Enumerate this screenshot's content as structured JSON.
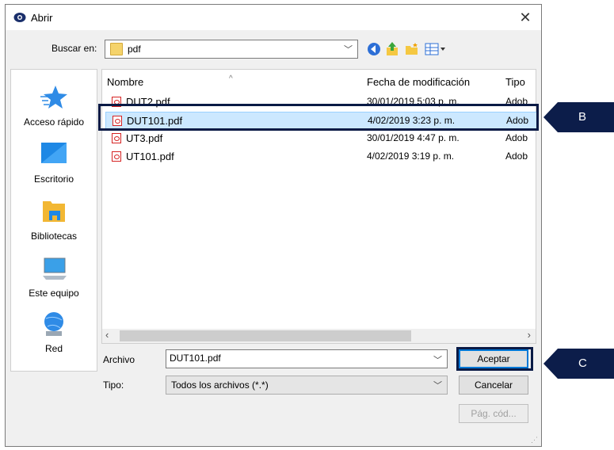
{
  "window": {
    "title": "Abrir",
    "close_glyph": "✕"
  },
  "lookin": {
    "label": "Buscar en:",
    "value": "pdf"
  },
  "places": [
    {
      "label": "Acceso rápido",
      "icon": "star-icon"
    },
    {
      "label": "Escritorio",
      "icon": "desktop-icon"
    },
    {
      "label": "Bibliotecas",
      "icon": "library-icon"
    },
    {
      "label": "Este equipo",
      "icon": "computer-icon"
    },
    {
      "label": "Red",
      "icon": "network-icon"
    }
  ],
  "columns": {
    "name": "Nombre",
    "date": "Fecha de modificación",
    "type": "Tipo"
  },
  "files": [
    {
      "name": "DUT2.pdf",
      "date": "30/01/2019 5:03 p. m.",
      "type": "Adob"
    },
    {
      "name": "DUT101.pdf",
      "date": "4/02/2019 3:23 p. m.",
      "type": "Adob"
    },
    {
      "name": "UT3.pdf",
      "date": "30/01/2019 4:47 p. m.",
      "type": "Adob"
    },
    {
      "name": "UT101.pdf",
      "date": "4/02/2019 3:19 p. m.",
      "type": "Adob"
    }
  ],
  "filename": {
    "label": "Archivo",
    "value": "DUT101.pdf"
  },
  "filetype": {
    "label": "Tipo:",
    "value": "Todos los archivos (*.*)"
  },
  "buttons": {
    "accept": "Aceptar",
    "cancel": "Cancelar",
    "codepage": "Pág. cód..."
  },
  "callouts": {
    "b": "B",
    "c": "C"
  },
  "colors": {
    "callout": "#0c1d4a",
    "selection": "#cce8ff",
    "accent": "#0078d7"
  }
}
